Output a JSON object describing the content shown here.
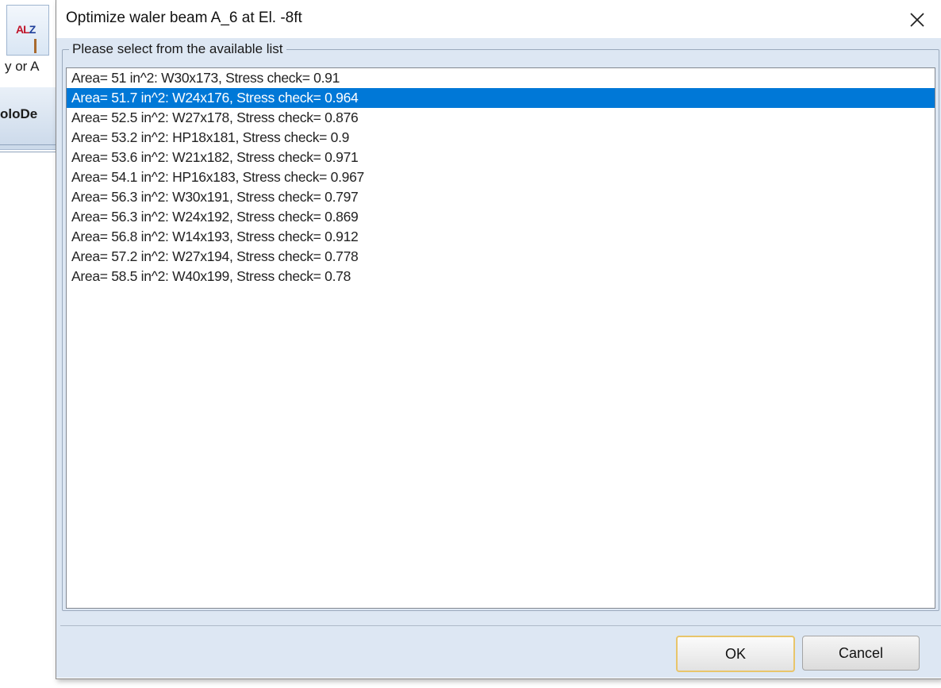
{
  "background_app": {
    "label_1": "y or A",
    "label_2": "oloDe",
    "logo_text_a": "A",
    "logo_text_l": "L",
    "logo_text_z": "Z"
  },
  "dialog": {
    "title": "Optimize waler beam A_6 at El. -8ft",
    "close_glyph": "✕",
    "group_label": "Please select from the available list",
    "selected_index": 1,
    "items": [
      "Area= 51 in^2: W30x173, Stress check= 0.91",
      "Area= 51.7 in^2: W24x176, Stress check= 0.964",
      "Area= 52.5 in^2: W27x178, Stress check= 0.876",
      "Area= 53.2 in^2: HP18x181, Stress check= 0.9",
      "Area= 53.6 in^2: W21x182, Stress check= 0.971",
      "Area= 54.1 in^2: HP16x183, Stress check= 0.967",
      "Area= 56.3 in^2: W30x191, Stress check= 0.797",
      "Area= 56.3 in^2: W24x192, Stress check= 0.869",
      "Area= 56.8 in^2: W14x193, Stress check= 0.912",
      "Area= 57.2 in^2: W27x194, Stress check= 0.778",
      "Area= 58.5 in^2: W40x199, Stress check= 0.78"
    ],
    "ok_label": "OK",
    "cancel_label": "Cancel"
  },
  "colors": {
    "selection": "#0078d7",
    "client_bg": "#dde7f3",
    "ok_border": "#e8c56b"
  }
}
